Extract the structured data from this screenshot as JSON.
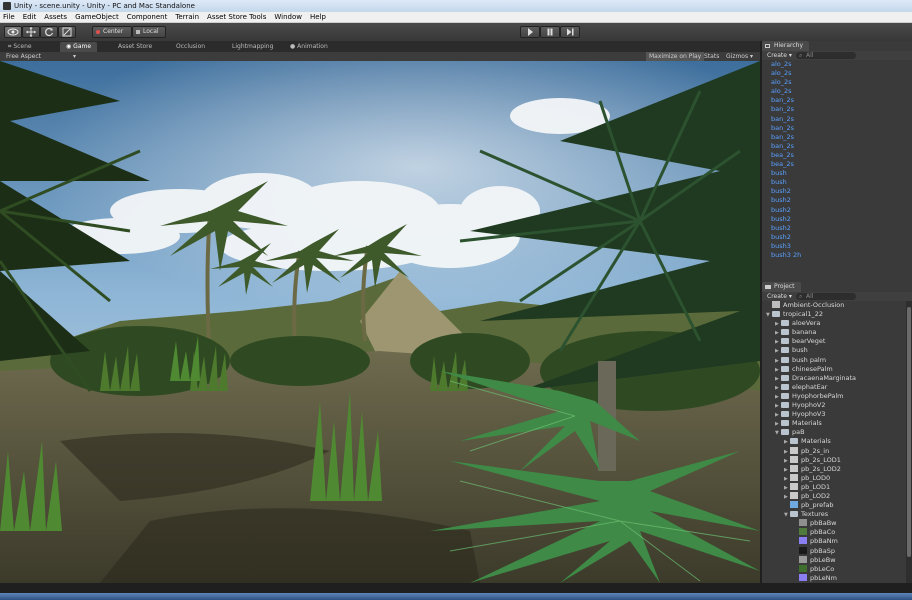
{
  "window": {
    "title": "Unity - scene.unity - Unity - PC and Mac Standalone"
  },
  "menu": [
    "File",
    "Edit",
    "Assets",
    "GameObject",
    "Component",
    "Terrain",
    "Asset Store Tools",
    "Window",
    "Help"
  ],
  "toolbar": {
    "pivot_label": "Center",
    "space_label": "Local"
  },
  "tabs": [
    {
      "label": "Scene"
    },
    {
      "label": "Game"
    },
    {
      "label": "Asset Store"
    },
    {
      "label": "Occlusion"
    },
    {
      "label": "Lightmapping"
    },
    {
      "label": "Animation"
    }
  ],
  "game_view": {
    "aspect": "Free Aspect",
    "maximize": "Maximize on Play",
    "stats": "Stats",
    "gizmos": "Gizmos"
  },
  "hierarchy": {
    "title": "Hierarchy",
    "create": "Create",
    "search_placeholder": "All",
    "items": [
      "alo_2s",
      "alo_2s",
      "alo_2s",
      "alo_2s",
      "ban_2s",
      "ban_2s",
      "ban_2s",
      "ban_2s",
      "ban_2s",
      "ban_2s",
      "bea_2s",
      "bea_2s",
      "bush",
      "bush",
      "bush2",
      "bush2",
      "bush2",
      "bush2",
      "bush2",
      "bush2",
      "bush3",
      "bush3 2h"
    ]
  },
  "project": {
    "title": "Project",
    "create": "Create",
    "search_placeholder": "All",
    "items": [
      {
        "label": "Ambient-Occlusion",
        "kind": "file",
        "depth": 0,
        "expanded": false
      },
      {
        "label": "tropical1_22",
        "kind": "folder",
        "depth": 0,
        "expanded": true
      },
      {
        "label": "aloeVera",
        "kind": "folder",
        "depth": 1,
        "expanded": false
      },
      {
        "label": "banana",
        "kind": "folder",
        "depth": 1,
        "expanded": false
      },
      {
        "label": "bearVeget",
        "kind": "folder",
        "depth": 1,
        "expanded": false
      },
      {
        "label": "bush",
        "kind": "folder",
        "depth": 1,
        "expanded": false
      },
      {
        "label": "bush palm",
        "kind": "folder",
        "depth": 1,
        "expanded": false
      },
      {
        "label": "chinesePalm",
        "kind": "folder",
        "depth": 1,
        "expanded": false
      },
      {
        "label": "DracaenaMarginata",
        "kind": "folder",
        "depth": 1,
        "expanded": false
      },
      {
        "label": "elephatEar",
        "kind": "folder",
        "depth": 1,
        "expanded": false
      },
      {
        "label": "HyophorbePalm",
        "kind": "folder",
        "depth": 1,
        "expanded": false
      },
      {
        "label": "HyophoV2",
        "kind": "folder",
        "depth": 1,
        "expanded": false
      },
      {
        "label": "HyophoV3",
        "kind": "folder",
        "depth": 1,
        "expanded": false
      },
      {
        "label": "Materials",
        "kind": "folder",
        "depth": 1,
        "expanded": false
      },
      {
        "label": "paB",
        "kind": "folder",
        "depth": 1,
        "expanded": true
      },
      {
        "label": "Materials",
        "kind": "folder",
        "depth": 2,
        "expanded": false
      },
      {
        "label": "pb_2s_in",
        "kind": "mesh",
        "depth": 2,
        "expanded": false
      },
      {
        "label": "pb_2s_LOD1",
        "kind": "mesh",
        "depth": 2,
        "expanded": false
      },
      {
        "label": "pb_2s_LOD2",
        "kind": "mesh",
        "depth": 2,
        "expanded": false
      },
      {
        "label": "pb_LOD0",
        "kind": "mesh",
        "depth": 2,
        "expanded": false
      },
      {
        "label": "pb_LOD1",
        "kind": "mesh",
        "depth": 2,
        "expanded": false
      },
      {
        "label": "pb_LOD2",
        "kind": "mesh",
        "depth": 2,
        "expanded": false
      },
      {
        "label": "pb_prefab",
        "kind": "prefab",
        "depth": 2,
        "expanded": false
      },
      {
        "label": "Textures",
        "kind": "folder",
        "depth": 2,
        "expanded": true
      },
      {
        "label": "pbBaBw",
        "kind": "texture",
        "depth": 3,
        "color": "#8f8f8f"
      },
      {
        "label": "pbBaCo",
        "kind": "texture",
        "depth": 3,
        "color": "#4f7a3c"
      },
      {
        "label": "pbBaNm",
        "kind": "texture",
        "depth": 3,
        "color": "#8a7ef0"
      },
      {
        "label": "pbBaSp",
        "kind": "texture",
        "depth": 3,
        "color": "#1a1a1a"
      },
      {
        "label": "pbLeBw",
        "kind": "texture",
        "depth": 3,
        "color": "#9a9a9a"
      },
      {
        "label": "pbLeCo",
        "kind": "texture",
        "depth": 3,
        "color": "#3e6e2e"
      },
      {
        "label": "pbLeNm",
        "kind": "texture",
        "depth": 3,
        "color": "#8a7ef0"
      }
    ]
  }
}
